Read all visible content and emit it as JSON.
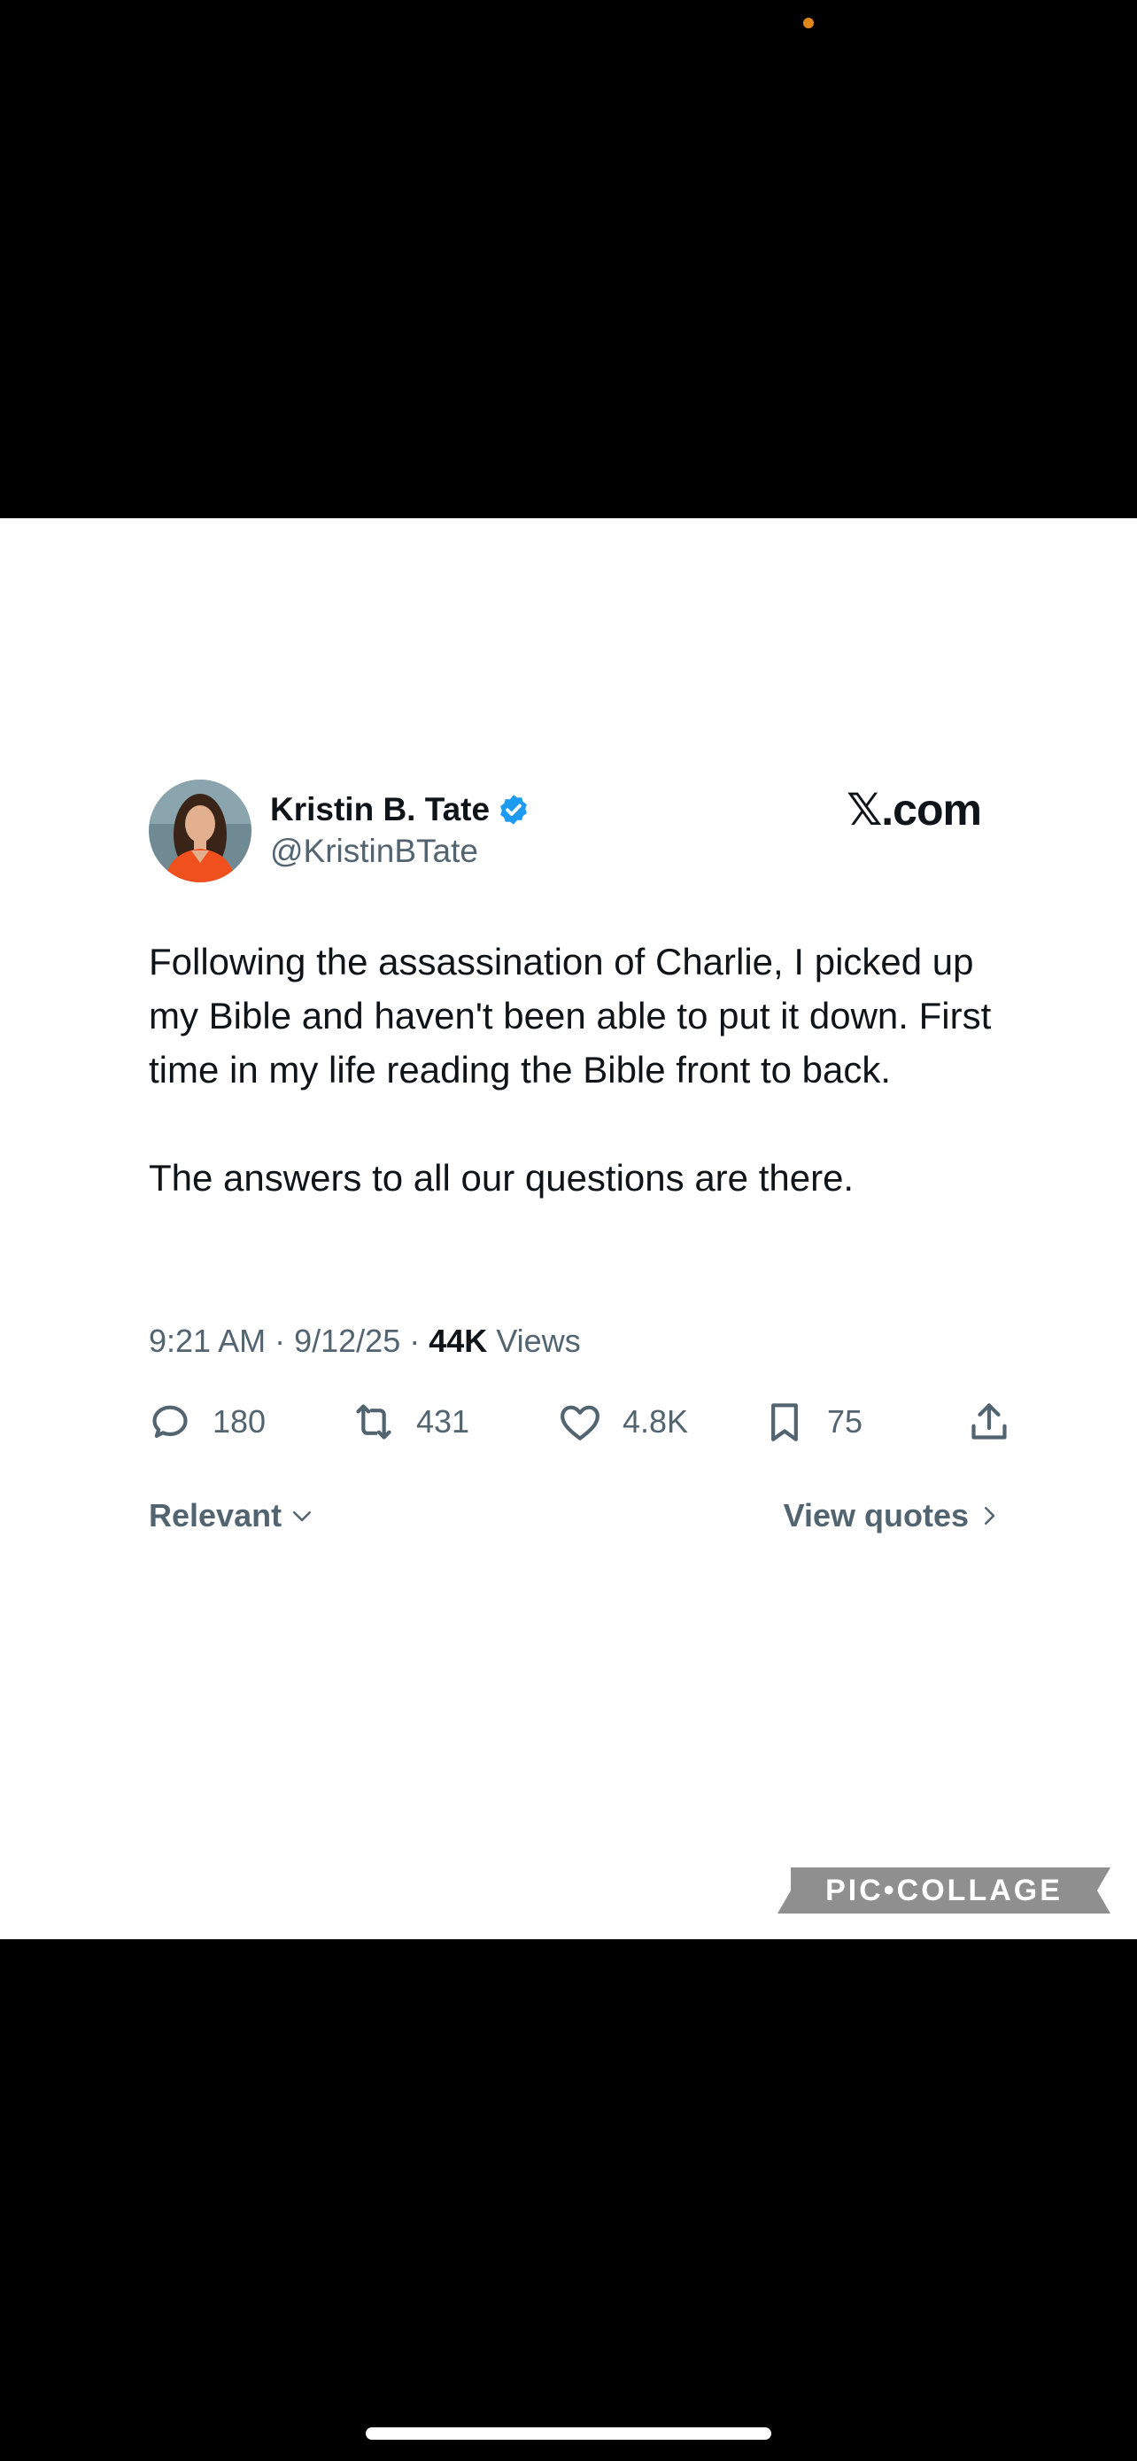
{
  "tweet": {
    "display_name": "Kristin B. Tate",
    "handle": "@KristinBTate",
    "brand": "𝕏.com",
    "text_paragraphs": [
      "Following the assassination of Charlie, I picked up my Bible and haven't been able to put it down. First time in my life reading the Bible front to back.",
      "The answers to all our questions are there."
    ],
    "time": "9:21 AM",
    "date": "9/12/25",
    "views_count": "44K",
    "views_label": "Views"
  },
  "actions": {
    "replies": "180",
    "reposts": "431",
    "likes": "4.8K",
    "bookmarks": "75"
  },
  "filter": {
    "sort_label": "Relevant",
    "quotes_label": "View quotes"
  },
  "watermark": "PIC•COLLAGE",
  "colors": {
    "text_primary": "#0f1419",
    "text_secondary": "#536471",
    "verified_blue": "#1d9bf0",
    "status_dot": "#e0871a"
  }
}
